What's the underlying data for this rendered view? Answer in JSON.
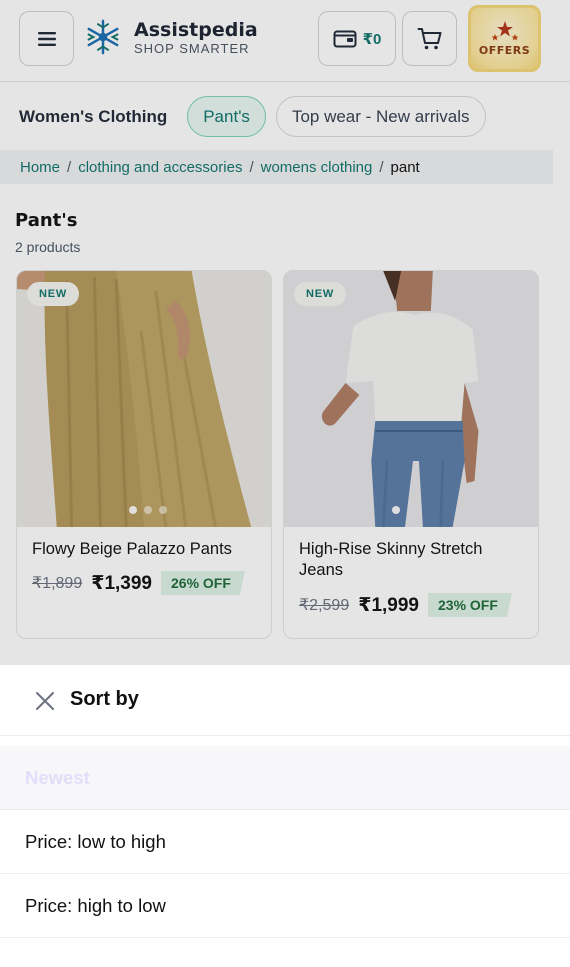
{
  "header": {
    "brand_name": "Assistpedia",
    "brand_tagline": "SHOP SMARTER",
    "wallet_amount": "₹0",
    "offers_label": "OFFERS"
  },
  "category_bar": {
    "title": "Women's Clothing",
    "pills": [
      {
        "label": "Pant's",
        "active": true
      },
      {
        "label": "Top wear - New arrivals",
        "active": false
      }
    ]
  },
  "breadcrumb": {
    "items": [
      "Home",
      "clothing and accessories",
      "womens clothing"
    ],
    "current": "pant"
  },
  "listing": {
    "title": "Pant's",
    "count": "2 products",
    "products": [
      {
        "badge": "NEW",
        "name": "Flowy Beige Palazzo Pants",
        "mrp": "₹1,899",
        "price": "₹1,399",
        "discount": "26% OFF",
        "image_dots": 3,
        "image_active": 0
      },
      {
        "badge": "NEW",
        "name": "High-Rise Skinny Stretch Jeans",
        "mrp": "₹2,599",
        "price": "₹1,999",
        "discount": "23% OFF",
        "image_dots": 1,
        "image_active": 0
      }
    ]
  },
  "sort_sheet": {
    "title": "Sort by",
    "options": [
      {
        "label": "Newest",
        "selected": true
      },
      {
        "label": "Price: low to high",
        "selected": false
      },
      {
        "label": "Price: high to low",
        "selected": false
      }
    ]
  },
  "colors": {
    "accent": "#0f766e",
    "discount_bg": "#dff3e6",
    "offers_bg": "#fde7a0"
  },
  "icons": {
    "menu": "hamburger-icon",
    "wallet": "wallet-icon",
    "cart": "cart-icon",
    "offers": "star-icon",
    "close": "close-icon"
  }
}
